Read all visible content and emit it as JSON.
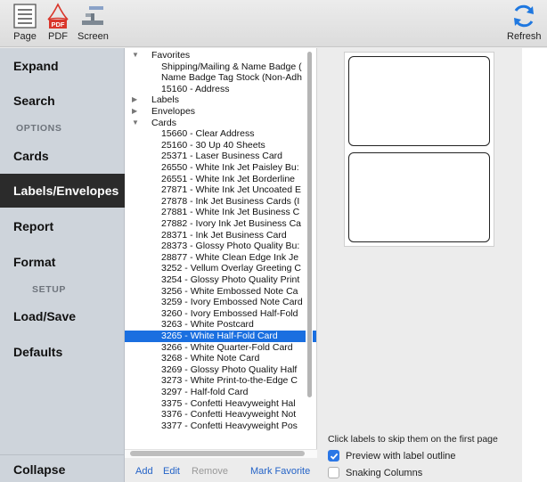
{
  "toolbar": {
    "page_label": "Page",
    "pdf_label": "PDF",
    "screen_label": "Screen",
    "refresh_label": "Refresh",
    "pdf_badge": "PDF"
  },
  "sidebar": {
    "expand": "Expand",
    "search": "Search",
    "options_heading": "OPTIONS",
    "cards": "Cards",
    "labels_envelopes": "Labels/Envelopes",
    "report": "Report",
    "format": "Format",
    "setup_heading": "SETUP",
    "load_save": "Load/Save",
    "defaults": "Defaults",
    "collapse": "Collapse"
  },
  "tree": [
    {
      "text": "Favorites",
      "level": 0,
      "disclosure": "expanded"
    },
    {
      "text": "Shipping/Mailing & Name Badge (",
      "level": 1
    },
    {
      "text": "Name Badge Tag Stock (Non-Adh",
      "level": 1
    },
    {
      "text": "15160 - Address",
      "level": 1
    },
    {
      "text": "Labels",
      "level": 0,
      "disclosure": "collapsed"
    },
    {
      "text": "Envelopes",
      "level": 0,
      "disclosure": "collapsed"
    },
    {
      "text": "Cards",
      "level": 0,
      "disclosure": "expanded"
    },
    {
      "text": "15660 - Clear Address",
      "level": 1
    },
    {
      "text": "25160 - 30 Up 40 Sheets",
      "level": 1
    },
    {
      "text": "25371 - Laser Business Card",
      "level": 1
    },
    {
      "text": "26550 - White Ink Jet Paisley Bu:",
      "level": 1
    },
    {
      "text": "26551 - White Ink Jet Borderline",
      "level": 1
    },
    {
      "text": "27871 - White Ink Jet Uncoated E",
      "level": 1
    },
    {
      "text": "27878 - Ink Jet Business Cards (I",
      "level": 1
    },
    {
      "text": "27881 - White Ink Jet Business C",
      "level": 1
    },
    {
      "text": "27882 - Ivory Ink Jet Business Ca",
      "level": 1
    },
    {
      "text": "28371 - Ink Jet Business Card",
      "level": 1
    },
    {
      "text": "28373 - Glossy Photo Quality Bu:",
      "level": 1
    },
    {
      "text": "28877 - White Clean Edge Ink Je",
      "level": 1
    },
    {
      "text": "3252 - Vellum Overlay Greeting C",
      "level": 1
    },
    {
      "text": "3254 - Glossy Photo Quality Print",
      "level": 1
    },
    {
      "text": "3256 - White Embossed Note Ca",
      "level": 1
    },
    {
      "text": "3259 - Ivory Embossed Note Card",
      "level": 1
    },
    {
      "text": "3260 - Ivory Embossed Half-Fold",
      "level": 1
    },
    {
      "text": "3263 - White Postcard",
      "level": 1
    },
    {
      "text": "3265 - White Half-Fold Card",
      "level": 1,
      "selected": true
    },
    {
      "text": "3266 - White Quarter-Fold Card",
      "level": 1
    },
    {
      "text": "3268 - White Note Card",
      "level": 1
    },
    {
      "text": "3269 - Glossy Photo Quality Half",
      "level": 1
    },
    {
      "text": "3273 - White Print-to-the-Edge C",
      "level": 1
    },
    {
      "text": "3297 - Half-fold Card",
      "level": 1
    },
    {
      "text": "3375 - Confetti Heavyweight Hal",
      "level": 1
    },
    {
      "text": "3376 - Confetti Heavyweight Not",
      "level": 1
    },
    {
      "text": "3377 - Confetti Heavyweight Pos",
      "level": 1
    }
  ],
  "actions": {
    "add": "Add",
    "edit": "Edit",
    "remove": "Remove",
    "mark_favorite": "Mark Favorite"
  },
  "preview": {
    "hint": "Click labels to skip them on the first page",
    "preview_outline_label": "Preview with label outline",
    "preview_outline_checked": true,
    "snaking_label": "Snaking Columns",
    "snaking_checked": false
  },
  "colors": {
    "selection": "#1a6fe0",
    "sidebar_bg": "#ced4db",
    "sidebar_selected": "#2b2b2b",
    "link": "#2463c7",
    "checkbox_on": "#2b77e6"
  }
}
